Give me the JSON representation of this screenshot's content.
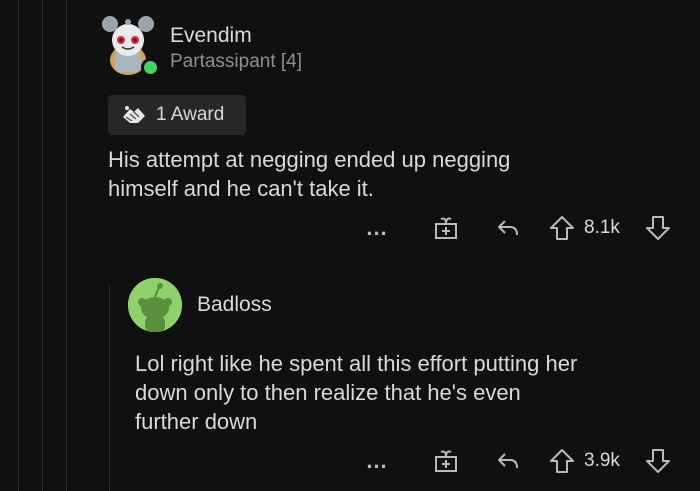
{
  "comments": [
    {
      "username": "Evendim",
      "flair": "Partassipant [4]",
      "award_label": "1 Award",
      "body_line1": "His attempt at negging ended up negging",
      "body_line2": "himself and he can't take it.",
      "votes": "8.1k",
      "more_label": "..."
    },
    {
      "username": "Badloss",
      "body_line1": "Lol right like he spent all this effort putting her",
      "body_line2": "down only to then realize that he's even",
      "body_line3": "further down",
      "votes": "3.9k",
      "more_label": "..."
    }
  ],
  "colors": {
    "background": "#101010",
    "thread_line": "#2f3031",
    "online": "#46d160",
    "avatar_green": "#8fd16b",
    "text": "#d7dadc",
    "muted": "#8d8f91"
  },
  "icons": [
    "snoo-avatar-icon",
    "award-hands-icon",
    "more-dots-icon",
    "gift-award-icon",
    "reply-icon",
    "upvote-icon",
    "downvote-icon"
  ]
}
